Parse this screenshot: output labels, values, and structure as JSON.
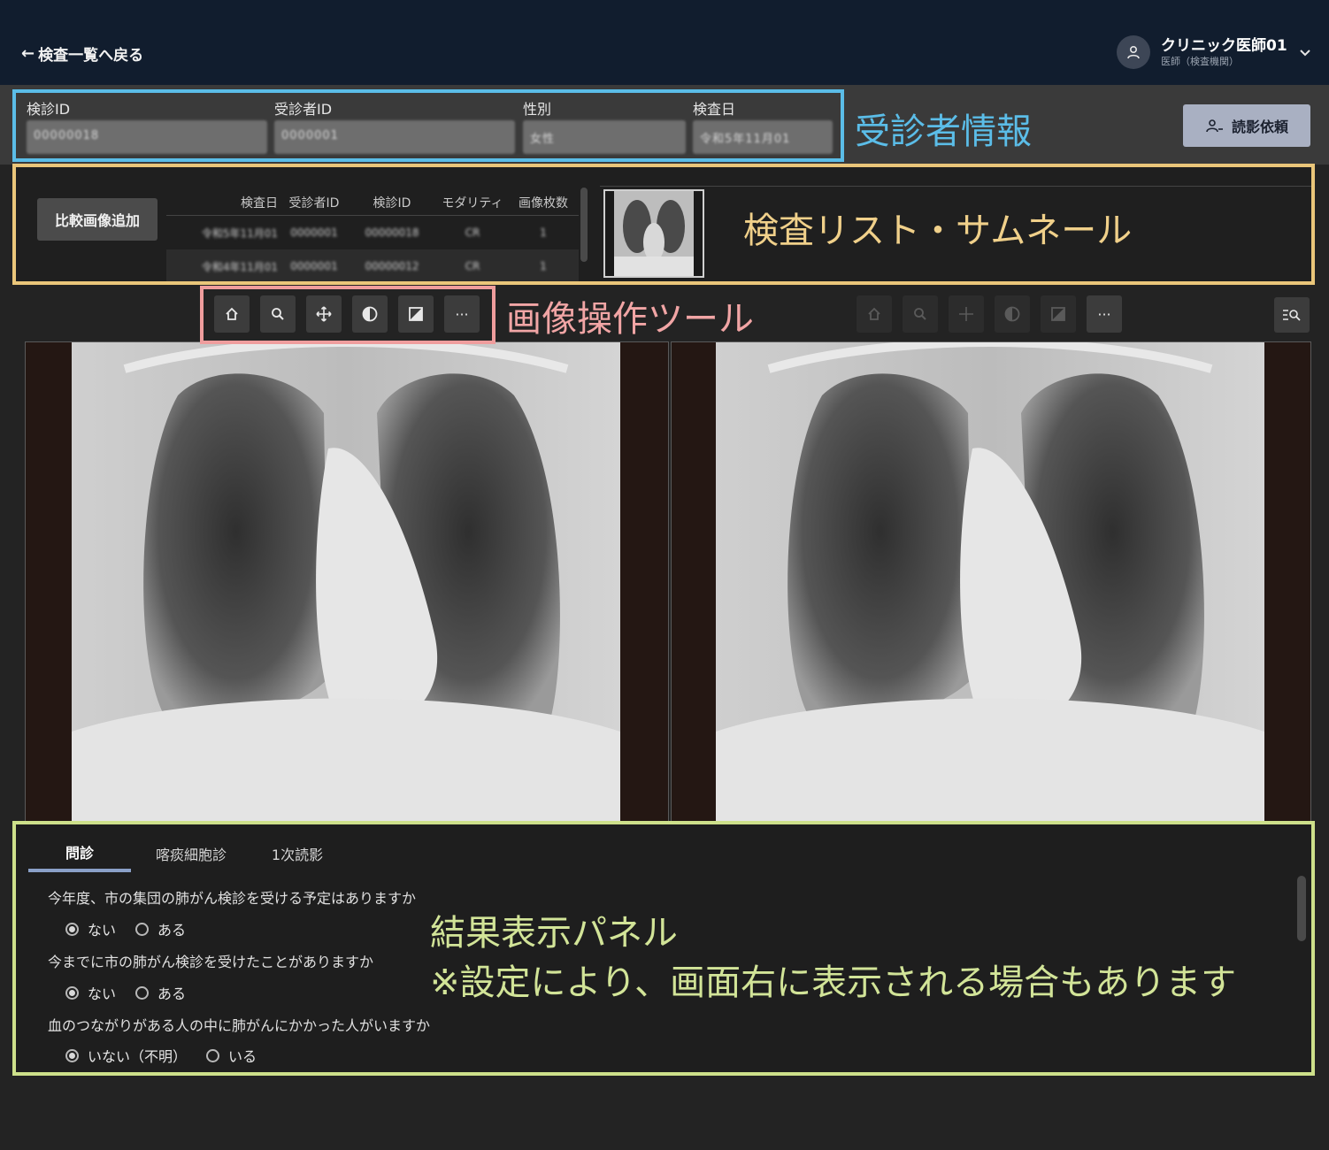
{
  "header": {
    "back_label": "検査一覧へ戻る",
    "user_name": "クリニック医師01",
    "user_role": "医師（検査機関）"
  },
  "patient": {
    "fields": [
      {
        "label": "検診ID",
        "value": "00000018"
      },
      {
        "label": "受診者ID",
        "value": "0000001"
      },
      {
        "label": "性別",
        "value": "女性"
      },
      {
        "label": "検査日",
        "value": "令和5年11月01"
      }
    ],
    "read_request_label": "読影依頼"
  },
  "exam_list": {
    "compare_button": "比較画像追加",
    "columns": [
      "検査日",
      "受診者ID",
      "検診ID",
      "モダリティ",
      "画像枚数"
    ],
    "rows": [
      [
        "令和5年11月01",
        "0000001",
        "00000018",
        "CR",
        "1"
      ],
      [
        "令和4年11月01",
        "0000001",
        "00000012",
        "CR",
        "1"
      ]
    ]
  },
  "annotations": {
    "patient_info": "受診者情報",
    "exam_list": "検査リスト・サムネール",
    "image_tools": "画像操作ツール",
    "result_panel": "結果表示パネル",
    "result_note": "※設定により、画面右に表示される場合もあります"
  },
  "toolbar": {
    "icons": [
      "home-icon",
      "search-icon",
      "move-icon",
      "contrast-icon",
      "invert-icon",
      "more-icon"
    ],
    "more_label": "···"
  },
  "results": {
    "tabs": [
      "問診",
      "喀痰細胞診",
      "1次読影"
    ],
    "active_tab": "問診",
    "questions": [
      {
        "text": "今年度、市の集団の肺がん検診を受ける予定はありますか",
        "options": [
          "ない",
          "ある"
        ],
        "selected": 0
      },
      {
        "text": "今までに市の肺がん検診を受けたことがありますか",
        "options": [
          "ない",
          "ある"
        ],
        "selected": 0
      },
      {
        "text": "血のつながりがある人の中に肺がんにかかった人がいますか",
        "options": [
          "いない（不明）",
          "いる"
        ],
        "selected": 0
      }
    ]
  },
  "colors": {
    "header_bg": "#111d2e",
    "annotation_blue": "#5bbde8",
    "annotation_yellow": "#eac67a",
    "annotation_pink": "#ef9d9d",
    "annotation_green": "#cde08a"
  }
}
